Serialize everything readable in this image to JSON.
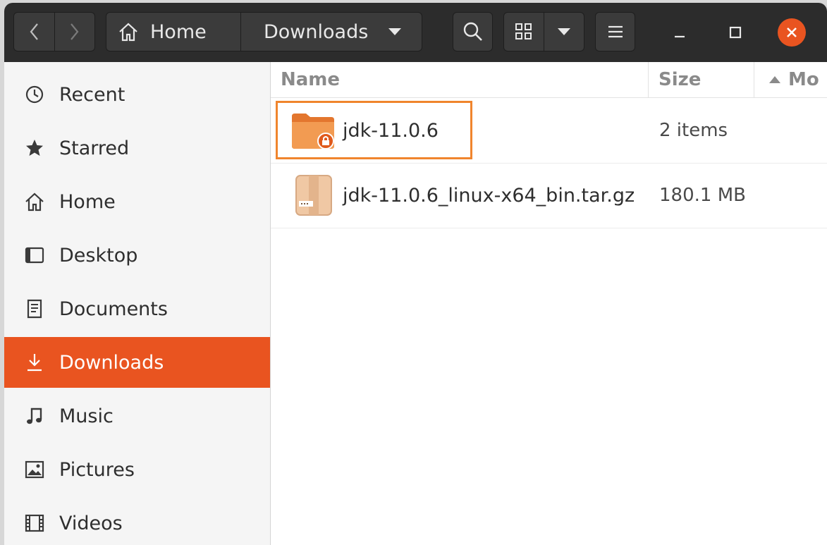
{
  "header": {
    "path": [
      "Home",
      "Downloads"
    ],
    "colors": {
      "headerbar": "#2c2c2c",
      "accent": "#e95420"
    }
  },
  "sidebar": {
    "items": [
      {
        "label": "Recent",
        "icon": "clock-icon",
        "active": false
      },
      {
        "label": "Starred",
        "icon": "star-icon",
        "active": false
      },
      {
        "label": "Home",
        "icon": "home-icon",
        "active": false
      },
      {
        "label": "Desktop",
        "icon": "desktop-icon",
        "active": false
      },
      {
        "label": "Documents",
        "icon": "document-icon",
        "active": false
      },
      {
        "label": "Downloads",
        "icon": "download-icon",
        "active": true
      },
      {
        "label": "Music",
        "icon": "music-note-icon",
        "active": false
      },
      {
        "label": "Pictures",
        "icon": "picture-icon",
        "active": false
      },
      {
        "label": "Videos",
        "icon": "film-icon",
        "active": false
      }
    ]
  },
  "files": {
    "columns": {
      "name": "Name",
      "size": "Size",
      "modified": "Mo"
    },
    "rows": [
      {
        "name": "jdk-11.0.6",
        "size": "2 items",
        "icon": "locked-folder-icon"
      },
      {
        "name": "jdk-11.0.6_linux-x64_bin.tar.gz",
        "size": "180.1 MB",
        "icon": "archive-icon"
      }
    ]
  }
}
